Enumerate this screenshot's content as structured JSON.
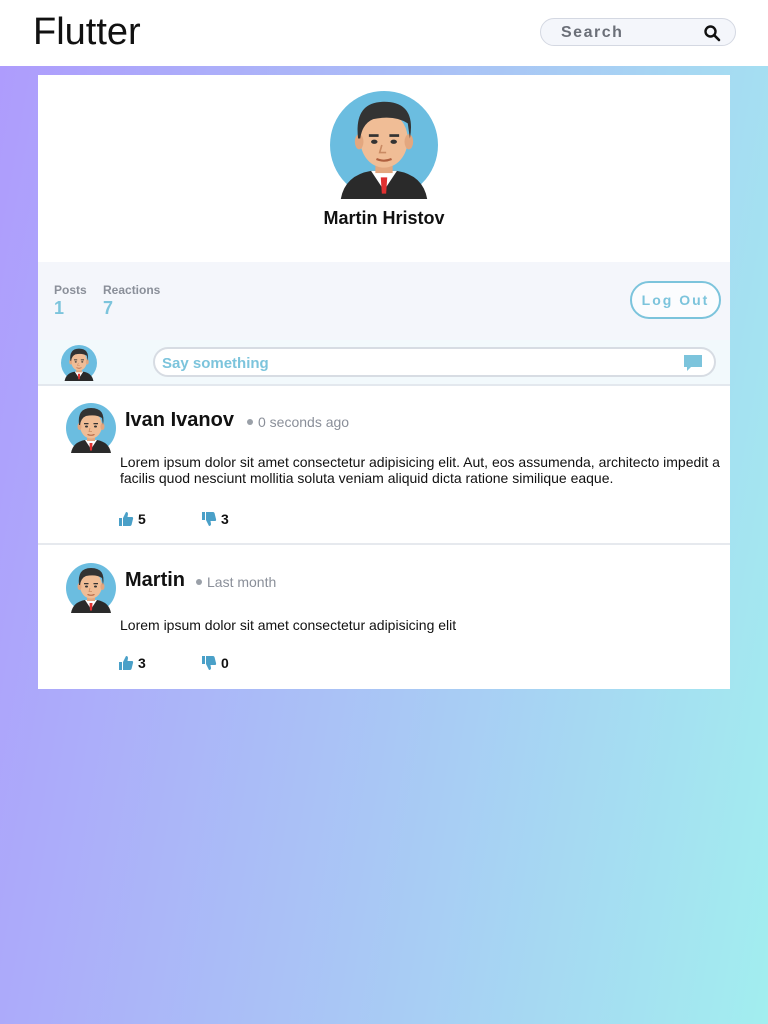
{
  "app": {
    "title": "Flutter"
  },
  "search": {
    "placeholder": "Search",
    "icon": "search-icon"
  },
  "profile": {
    "name": "Martin Hristov",
    "stats": [
      {
        "label": "Posts",
        "value": "1"
      },
      {
        "label": "Reactions",
        "value": "7"
      }
    ],
    "logout_label": "Log Out"
  },
  "composer": {
    "placeholder": "Say something",
    "icon": "chat-bubble-icon"
  },
  "posts": [
    {
      "author": "Ivan Ivanov",
      "time": "0 seconds ago",
      "text": "Lorem ipsum dolor sit amet consectetur adipisicing elit. Aut, eos assumenda, architecto impedit a facilis quod nesciunt mollitia soluta veniam aliquid dicta ratione similique eaque.",
      "likes": "5",
      "dislikes": "3"
    },
    {
      "author": "Martin",
      "time": "Last month",
      "text": "Lorem ipsum dolor sit amet consectetur adipisicing elit",
      "likes": "3",
      "dislikes": "0"
    }
  ],
  "colors": {
    "accent": "#7cc4dc",
    "gradient_start": "#ae9bfd",
    "gradient_end": "#a2eeef"
  }
}
